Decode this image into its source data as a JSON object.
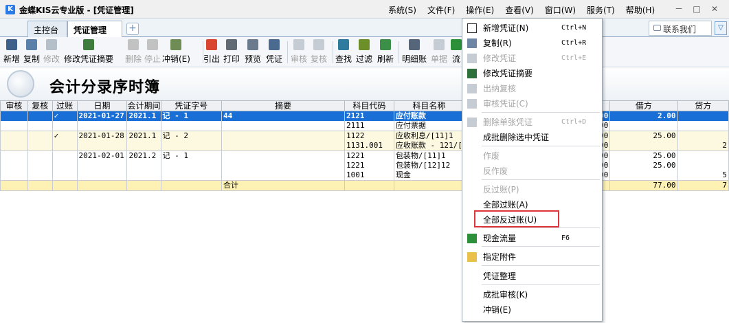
{
  "app": {
    "title": "金蝶KIS云专业版 - [凭证管理]",
    "logo": "K",
    "menus": [
      "系统(S)",
      "文件(F)",
      "操作(E)",
      "查看(V)",
      "窗口(W)",
      "服务(T)",
      "帮助(H)"
    ],
    "window_buttons": {
      "minimize": "－",
      "restore": "□",
      "close": "✕"
    }
  },
  "tabs": {
    "home": "主控台",
    "voucher": "凭证管理",
    "close": "✕",
    "add": "+",
    "contact": "联系我们",
    "collapse": "▽"
  },
  "toolbar": {
    "buttons": [
      {
        "label": "新增",
        "icon": "new-doc-icon",
        "enabled": true,
        "color": "#3d5f8a"
      },
      {
        "label": "复制",
        "icon": "copy-icon",
        "enabled": true,
        "color": "#5a7fa8"
      },
      {
        "label": "修改",
        "icon": "edit-icon",
        "enabled": false,
        "color": "#b5bfca"
      },
      {
        "label": "修改凭证摘要",
        "icon": "edit-summary-icon",
        "enabled": true,
        "color": "#3e7d3e"
      },
      {
        "label": "删除",
        "icon": "delete-icon",
        "enabled": false,
        "color": "#c2c2c2"
      },
      {
        "label": "停止",
        "icon": "stop-icon",
        "enabled": false,
        "color": "#c2c2c2"
      },
      {
        "label": "冲销(E)",
        "icon": "reverse-icon",
        "enabled": true,
        "color": "#6f8c55"
      },
      {
        "label": "引出",
        "icon": "export-icon",
        "enabled": true,
        "color": "#d9452e"
      },
      {
        "label": "打印",
        "icon": "print-icon",
        "enabled": true,
        "color": "#606a75"
      },
      {
        "label": "预览",
        "icon": "preview-icon",
        "enabled": true,
        "color": "#6b7a8c"
      },
      {
        "label": "凭证",
        "icon": "voucher-icon",
        "enabled": true,
        "color": "#4a6b8f"
      },
      {
        "label": "审核",
        "icon": "audit-icon",
        "enabled": false,
        "color": "#c5ccd4"
      },
      {
        "label": "复核",
        "icon": "recheck-icon",
        "enabled": false,
        "color": "#c5ccd4"
      },
      {
        "label": "查找",
        "icon": "find-icon",
        "enabled": true,
        "color": "#2f7b9e"
      },
      {
        "label": "过滤",
        "icon": "filter-icon",
        "enabled": true,
        "color": "#6c8f2a"
      },
      {
        "label": "刷新",
        "icon": "refresh-icon",
        "enabled": true,
        "color": "#3c8f47"
      },
      {
        "label": "明细账",
        "icon": "ledger-detail-icon",
        "enabled": true,
        "color": "#55657a"
      },
      {
        "label": "单据",
        "icon": "document-icon",
        "enabled": false,
        "color": "#c5ccd4"
      },
      {
        "label": "流",
        "icon": "flow-icon",
        "enabled": true,
        "color": "#2c8f3a"
      }
    ]
  },
  "report": {
    "title": "会计分录序时簿"
  },
  "table": {
    "headers": [
      "审核",
      "复核",
      "过账",
      "日期",
      "会计期间",
      "凭证字号",
      "摘要",
      "科目代码",
      "科目名称",
      "",
      "借方",
      "贷方"
    ],
    "rows": [
      {
        "style": "sel",
        "group_start": true,
        "cells": [
          "",
          "",
          "✓",
          "2021-01-27",
          "2021.1",
          "记 - 1",
          "44",
          "2121",
          "应付账款",
          "00",
          "2.00",
          ""
        ]
      },
      {
        "style": "white",
        "group_start": false,
        "cells": [
          "",
          "",
          "",
          "",
          "",
          "",
          "",
          "2111",
          "应付票据",
          "00",
          "",
          ""
        ]
      },
      {
        "style": "yellow",
        "group_start": true,
        "cells": [
          "",
          "",
          "✓",
          "2021-01-28",
          "2021.1",
          "记 - 2",
          "",
          "1122",
          "应收利息/[11]1",
          "00",
          "25.00",
          ""
        ]
      },
      {
        "style": "yellow",
        "group_start": false,
        "cells": [
          "",
          "",
          "",
          "",
          "",
          "",
          "",
          "1131.001",
          "应收账款 - 121/[",
          "00",
          "",
          "2"
        ]
      },
      {
        "style": "white",
        "group_start": true,
        "cells": [
          "",
          "",
          "",
          "2021-02-01",
          "2021.2",
          "记 - 1",
          "",
          "1221",
          "包装物/[11]1",
          "00",
          "25.00",
          ""
        ]
      },
      {
        "style": "white",
        "group_start": false,
        "cells": [
          "",
          "",
          "",
          "",
          "",
          "",
          "",
          "1221",
          "包装物/[12]12",
          "00",
          "25.00",
          ""
        ]
      },
      {
        "style": "white",
        "group_start": false,
        "cells": [
          "",
          "",
          "",
          "",
          "",
          "",
          "",
          "1001",
          "现金",
          "00",
          "",
          "5"
        ]
      },
      {
        "style": "total",
        "group_start": true,
        "cells": [
          "",
          "",
          "",
          "",
          "",
          "",
          "合计",
          "",
          "",
          "",
          "77.00",
          "7"
        ]
      }
    ]
  },
  "menu": {
    "items": [
      {
        "label": "新增凭证(N)",
        "shortcut": "Ctrl+N",
        "enabled": true,
        "icon": "new-voucher-icon"
      },
      {
        "label": "复制(R)",
        "shortcut": "Ctrl+R",
        "enabled": true,
        "icon": "copy-icon"
      },
      {
        "label": "修改凭证",
        "shortcut": "Ctrl+E",
        "enabled": false,
        "icon": "edit-icon"
      },
      {
        "label": "修改凭证摘要",
        "shortcut": "",
        "enabled": true,
        "icon": "edit-summary-icon"
      },
      {
        "label": "出纳复核",
        "shortcut": "",
        "enabled": false,
        "icon": "cashier-check-icon"
      },
      {
        "label": "审核凭证(C)",
        "shortcut": "",
        "enabled": false,
        "icon": "audit-icon",
        "sep_after": true
      },
      {
        "label": "删除单张凭证",
        "shortcut": "Ctrl+D",
        "enabled": false,
        "icon": "delete-icon"
      },
      {
        "label": "成批删除选中凭证",
        "shortcut": "",
        "enabled": true,
        "icon": "",
        "sep_after": true
      },
      {
        "label": "作废",
        "shortcut": "",
        "enabled": false,
        "icon": ""
      },
      {
        "label": "反作废",
        "shortcut": "",
        "enabled": false,
        "icon": "",
        "sep_after": true
      },
      {
        "label": "反过账(P)",
        "shortcut": "",
        "enabled": false,
        "icon": ""
      },
      {
        "label": "全部过账(A)",
        "shortcut": "",
        "enabled": true,
        "icon": ""
      },
      {
        "label": "全部反过账(U)",
        "shortcut": "",
        "enabled": true,
        "icon": "",
        "sep_after": true
      },
      {
        "label": "现金流量",
        "shortcut": "F6",
        "enabled": true,
        "icon": "cash-flow-icon",
        "sep_after": true
      },
      {
        "label": "指定附件",
        "shortcut": "",
        "enabled": true,
        "icon": "folder-icon",
        "sep_after": true
      },
      {
        "label": "凭证整理",
        "shortcut": "",
        "enabled": true,
        "icon": "",
        "sep_after": true
      },
      {
        "label": "成批审核(K)",
        "shortcut": "",
        "enabled": true,
        "icon": ""
      },
      {
        "label": "冲销(E)",
        "shortcut": "",
        "enabled": true,
        "icon": ""
      }
    ]
  }
}
